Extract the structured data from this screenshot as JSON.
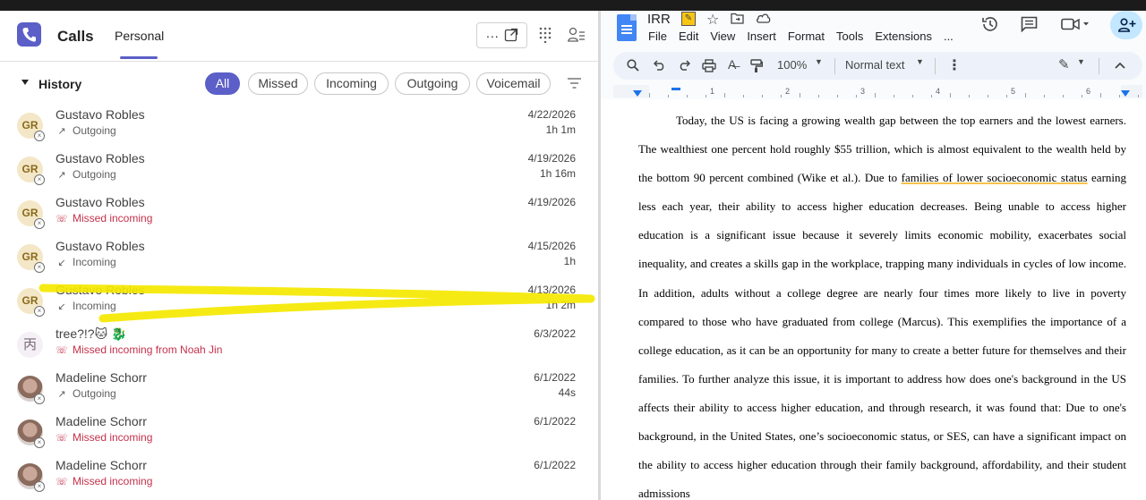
{
  "teams": {
    "title": "Calls",
    "tab": "Personal",
    "popout_dots": "...",
    "history_label": "History",
    "filters": [
      "All",
      "Missed",
      "Incoming",
      "Outgoing",
      "Voicemail"
    ],
    "active_filter": "All",
    "accent": "#5b5fc7",
    "missed_color": "#c4314b",
    "calls": [
      {
        "initials": "GR",
        "name": "Gustavo Robles",
        "type": "Outgoing",
        "status": "outgoing",
        "date": "4/22/2026",
        "duration": "1h 1m"
      },
      {
        "initials": "GR",
        "name": "Gustavo Robles",
        "type": "Outgoing",
        "status": "outgoing",
        "date": "4/19/2026",
        "duration": "1h 16m"
      },
      {
        "initials": "GR",
        "name": "Gustavo Robles",
        "type": "Missed incoming",
        "status": "missed",
        "date": "4/19/2026",
        "duration": ""
      },
      {
        "initials": "GR",
        "name": "Gustavo Robles",
        "type": "Incoming",
        "status": "incoming",
        "date": "4/15/2026",
        "duration": "1h"
      },
      {
        "initials": "GR",
        "name": "Gustavo Robles",
        "type": "Incoming",
        "status": "incoming",
        "date": "4/13/2026",
        "duration": "1h 2m"
      },
      {
        "initials": "丙",
        "name": "tree?!?🐱 🐉",
        "type": "Missed incoming from Noah Jin",
        "status": "missed",
        "date": "6/3/2022",
        "duration": ""
      },
      {
        "initials": "",
        "name": "Madeline Schorr",
        "type": "Outgoing",
        "status": "outgoing",
        "date": "6/1/2022",
        "duration": "44s"
      },
      {
        "initials": "",
        "name": "Madeline Schorr",
        "type": "Missed incoming",
        "status": "missed",
        "date": "6/1/2022",
        "duration": ""
      },
      {
        "initials": "",
        "name": "Madeline Schorr",
        "type": "Missed incoming",
        "status": "missed",
        "date": "6/1/2022",
        "duration": ""
      }
    ]
  },
  "docs": {
    "title": "IRR",
    "menu": [
      "File",
      "Edit",
      "View",
      "Insert",
      "Format",
      "Tools",
      "Extensions",
      "..."
    ],
    "zoom": "100%",
    "style": "Normal text",
    "ruler_numbers": [
      "1",
      "2",
      "3",
      "4",
      "5",
      "6"
    ],
    "text": {
      "p1": "Today, the US is facing a growing wealth gap between the top earners and the lowest earners. The wealthiest one percent hold roughly $55 trillion, which is almost equivalent to the wealth held by the bottom 90 percent combined (Wike et al.). Due to ",
      "underlined": "families of lower socioeconomic status",
      "p2": " earning less each year, their ability to access higher education decreases. Being unable to access higher education is a significant issue because it severely limits economic mobility, exacerbates social inequality, and creates a skills gap in the workplace, trapping many individuals in cycles of low income. In addition, adults without a college degree are nearly four times more likely to live in poverty compared to those who have graduated from college (Marcus). This exemplifies the importance of a college education, as it can be an opportunity for many to create a better future for themselves and their families. To further analyze this issue, it is important to address how does one's background in the US affects their ability to access higher education, and through research, it was found that: Due to one's background, in the United States, one’s socioeconomic status, or SES, can have a significant impact on the ability to access higher education through their family background, affordability, and their student admissions"
    }
  }
}
